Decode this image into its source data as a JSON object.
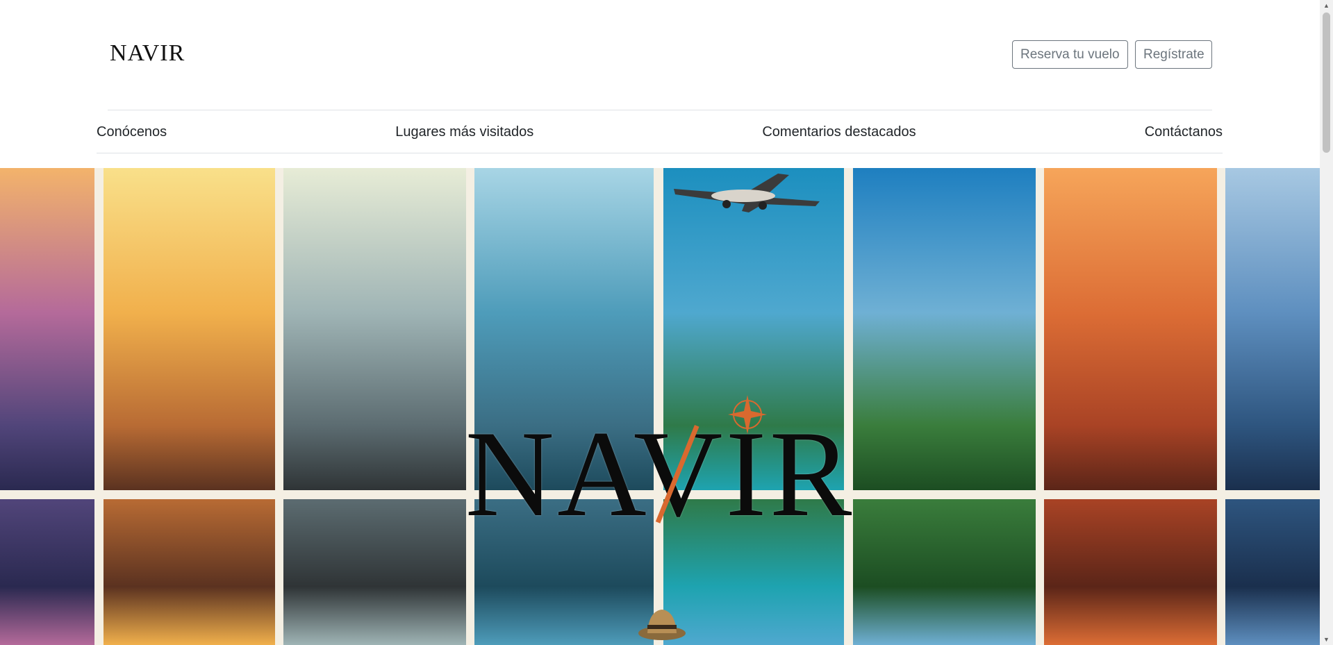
{
  "header": {
    "logo_text": "NAVIR",
    "buttons": {
      "booking": "Reserva tu vuelo",
      "register": "Regístrate"
    }
  },
  "nav": {
    "items": [
      {
        "label": "Conócenos"
      },
      {
        "label": "Lugares más visitados"
      },
      {
        "label": "Comentarios destacados"
      },
      {
        "label": "Contáctanos"
      }
    ]
  },
  "hero": {
    "logo_text": "NAVIR",
    "accent_color": "#d9692f",
    "tiles": [
      {
        "name": "purple-city",
        "colors": [
          "#f3b36b",
          "#b46a9a",
          "#51457a",
          "#2a2950"
        ]
      },
      {
        "name": "sunset-buildings",
        "colors": [
          "#f9e08a",
          "#f1b04c",
          "#b86b34",
          "#5b3220"
        ]
      },
      {
        "name": "skyscrapers",
        "colors": [
          "#e7ecd6",
          "#9fb4b5",
          "#5c6c71",
          "#2f3436"
        ]
      },
      {
        "name": "harbor-city",
        "colors": [
          "#a8d5e5",
          "#4e9cba",
          "#3b6e84",
          "#1d4a5c"
        ]
      },
      {
        "name": "airplane-lagoon",
        "colors": [
          "#1c8fbf",
          "#4fa8cf",
          "#2f7a49",
          "#1ea3b0"
        ]
      },
      {
        "name": "jungle-mountains",
        "colors": [
          "#1e7fc0",
          "#6fb0d4",
          "#3a7d3c",
          "#1c4d22"
        ]
      },
      {
        "name": "orange-mountains",
        "colors": [
          "#f6a55a",
          "#dc6d35",
          "#a94325",
          "#5b2518"
        ]
      },
      {
        "name": "blue-valley",
        "colors": [
          "#a7c8e2",
          "#5e8fbf",
          "#2e557f",
          "#1a2f4d"
        ]
      }
    ]
  }
}
